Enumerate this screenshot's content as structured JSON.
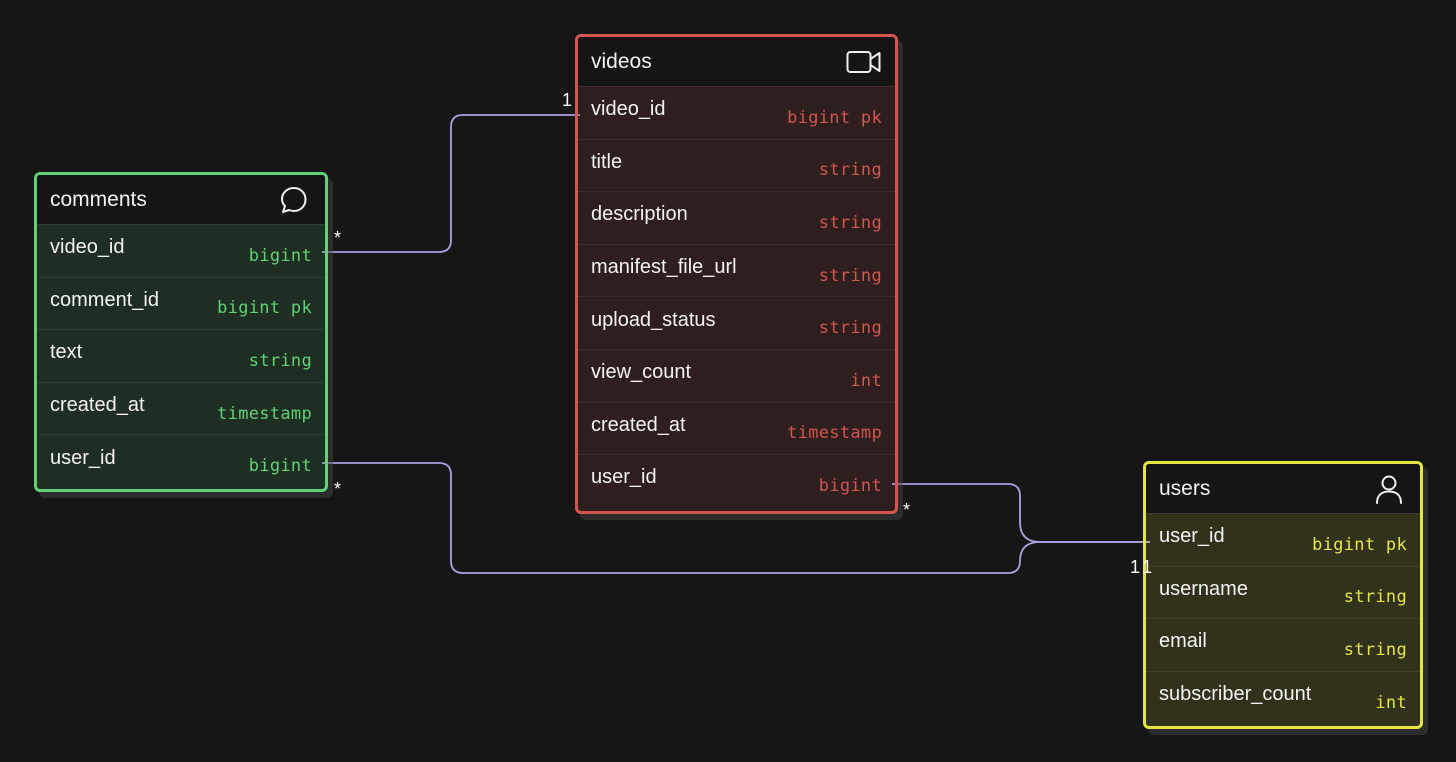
{
  "tables": {
    "videos": {
      "name": "videos",
      "icon": "video-camera-icon",
      "accent": "#d2554f",
      "fields": [
        {
          "name": "video_id",
          "type": "bigint",
          "key": "pk"
        },
        {
          "name": "title",
          "type": "string",
          "key": ""
        },
        {
          "name": "description",
          "type": "string",
          "key": ""
        },
        {
          "name": "manifest_file_url",
          "type": "string",
          "key": ""
        },
        {
          "name": "upload_status",
          "type": "string",
          "key": ""
        },
        {
          "name": "view_count",
          "type": "int",
          "key": ""
        },
        {
          "name": "created_at",
          "type": "timestamp",
          "key": ""
        },
        {
          "name": "user_id",
          "type": "bigint",
          "key": ""
        }
      ]
    },
    "comments": {
      "name": "comments",
      "icon": "chat-bubble-icon",
      "accent": "#5fd275",
      "fields": [
        {
          "name": "video_id",
          "type": "bigint",
          "key": ""
        },
        {
          "name": "comment_id",
          "type": "bigint",
          "key": "pk"
        },
        {
          "name": "text",
          "type": "string",
          "key": ""
        },
        {
          "name": "created_at",
          "type": "timestamp",
          "key": ""
        },
        {
          "name": "user_id",
          "type": "bigint",
          "key": ""
        }
      ]
    },
    "users": {
      "name": "users",
      "icon": "user-icon",
      "accent": "#e6e642",
      "fields": [
        {
          "name": "user_id",
          "type": "bigint",
          "key": "pk"
        },
        {
          "name": "username",
          "type": "string",
          "key": ""
        },
        {
          "name": "email",
          "type": "string",
          "key": ""
        },
        {
          "name": "subscriber_count",
          "type": "int",
          "key": ""
        }
      ]
    }
  },
  "relations": [
    {
      "from": "comments.video_id",
      "to": "videos.video_id",
      "from_card": "*",
      "to_card": "1"
    },
    {
      "from": "comments.user_id",
      "to": "users.user_id",
      "from_card": "*",
      "to_card": "1"
    },
    {
      "from": "videos.user_id",
      "to": "users.user_id",
      "from_card": "*",
      "to_card": "1"
    }
  ],
  "colors": {
    "background": "#161616",
    "relation_line": "#a9a2e2"
  }
}
